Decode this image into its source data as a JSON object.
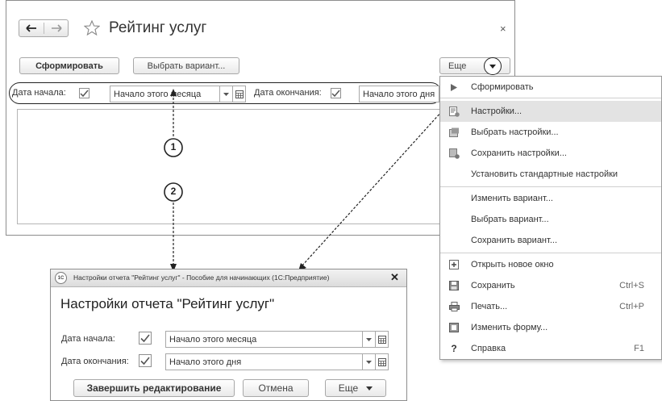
{
  "main_window": {
    "title": "Рейтинг услуг",
    "close_label": "×",
    "toolbar": {
      "generate_label": "Сформировать",
      "choose_variant_label": "Выбрать вариант...",
      "more_label": "Еще"
    },
    "period": {
      "start_label": "Дата начала:",
      "start_value": "Начало этого месяца",
      "end_label": "Дата окончания:",
      "end_value": "Начало этого дня"
    }
  },
  "callouts": [
    "1",
    "2"
  ],
  "menu": {
    "items": [
      {
        "label": "Сформировать",
        "icon": "play-icon",
        "shortcut": ""
      },
      {
        "label": "Настройки...",
        "icon": "settings-icon",
        "shortcut": "",
        "highlighted": true
      },
      {
        "label": "Выбрать настройки...",
        "icon": "choose-settings-icon",
        "shortcut": ""
      },
      {
        "label": "Сохранить настройки...",
        "icon": "save-settings-icon",
        "shortcut": ""
      },
      {
        "label": "Установить стандартные настройки",
        "icon": "",
        "shortcut": ""
      },
      {
        "label": "Изменить вариант...",
        "icon": "",
        "shortcut": ""
      },
      {
        "label": "Выбрать вариант...",
        "icon": "",
        "shortcut": ""
      },
      {
        "label": "Сохранить вариант...",
        "icon": "",
        "shortcut": ""
      },
      {
        "label": "Открыть новое окно",
        "icon": "new-window-icon",
        "shortcut": ""
      },
      {
        "label": "Сохранить",
        "icon": "floppy-icon",
        "shortcut": "Ctrl+S"
      },
      {
        "label": "Печать...",
        "icon": "printer-icon",
        "shortcut": "Ctrl+P"
      },
      {
        "label": "Изменить форму...",
        "icon": "form-icon",
        "shortcut": ""
      },
      {
        "label": "Справка",
        "icon": "help-icon",
        "shortcut": "F1"
      }
    ]
  },
  "dialog": {
    "window_title": "Настройки отчета \"Рейтинг услуг\" - Пособие для начинающих (1С:Предприятие)",
    "heading": "Настройки отчета \"Рейтинг услуг\"",
    "start_label": "Дата начала:",
    "start_value": "Начало этого месяца",
    "end_label": "Дата окончания:",
    "end_value": "Начало этого дня",
    "finish_label": "Завершить редактирование",
    "cancel_label": "Отмена",
    "more_label": "Еще",
    "logo_text": "1С"
  }
}
